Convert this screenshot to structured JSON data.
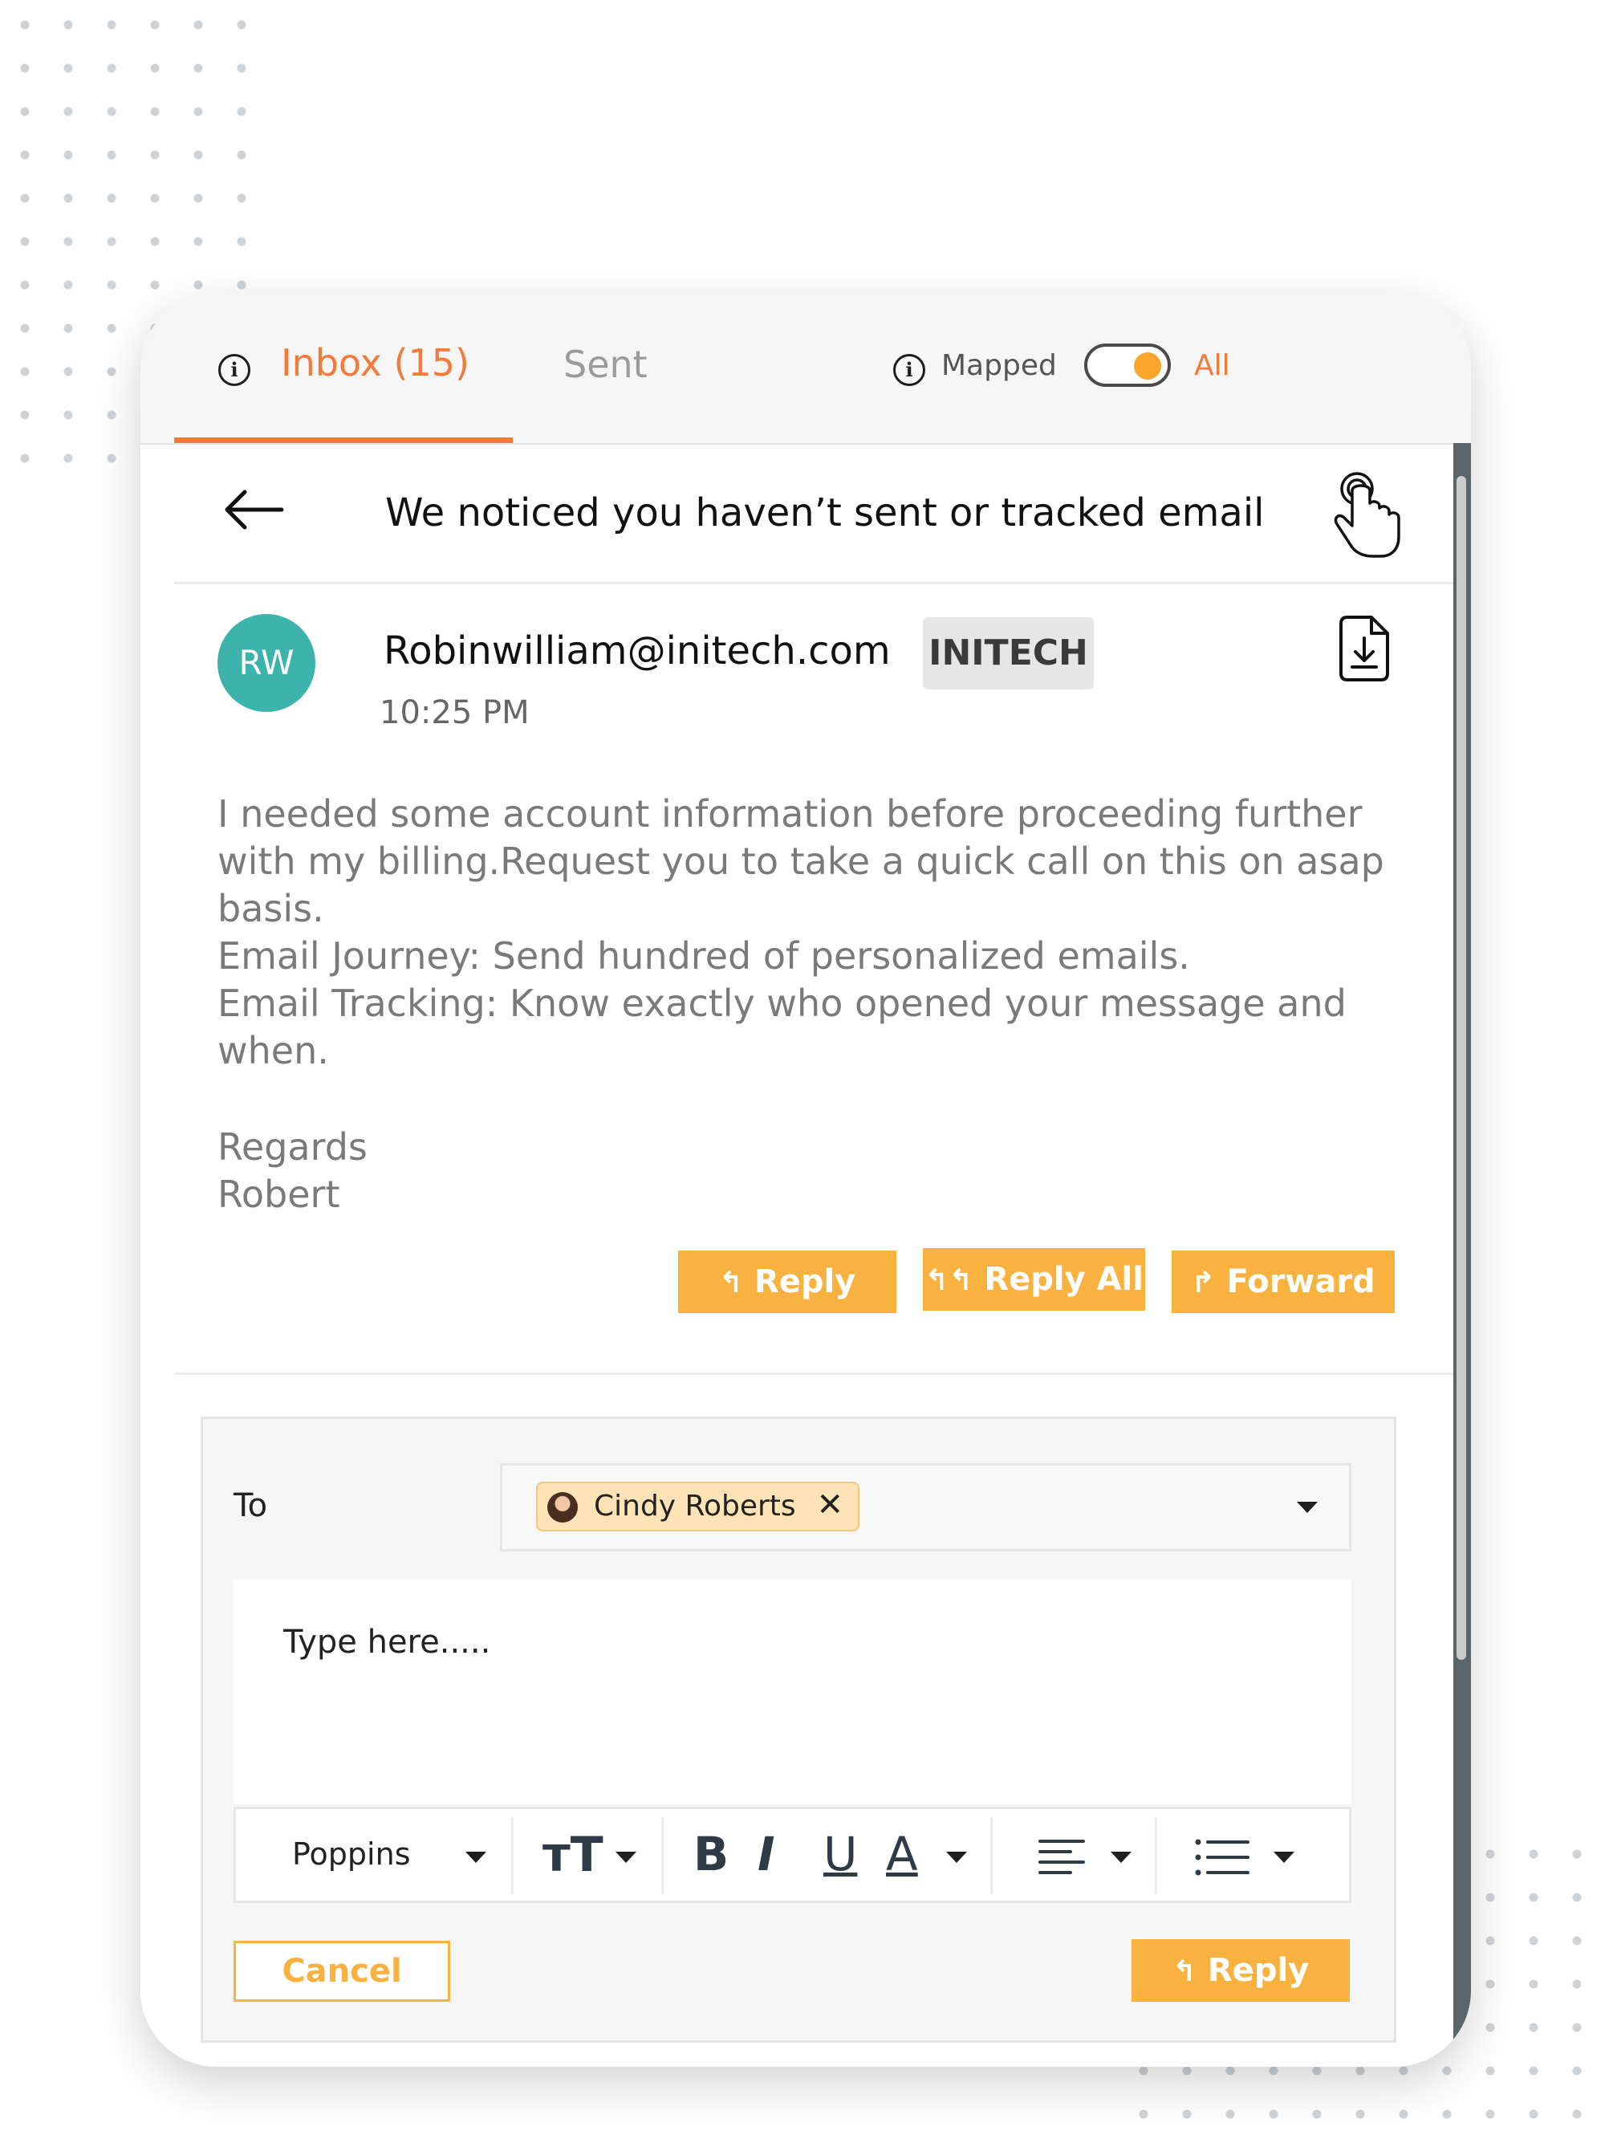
{
  "tabs": {
    "inbox_label": "Inbox (15)",
    "sent_label": "Sent",
    "mapped_label": "Mapped",
    "all_label": "All",
    "toggle_state": "All",
    "info_icon": "i"
  },
  "email": {
    "subject": "We noticed you haven’t sent or tracked email",
    "sender_initials": "RW",
    "sender_email": "Robinwilliam@initech.com",
    "company": "INITECH",
    "time": "10:25 PM",
    "body": [
      "I needed some account information before proceeding further with my billing.Request you to take a quick call on this on asap basis.",
      "Email Journey: Send hundred of personalized emails.",
      "Email Tracking: Know exactly who opened your message and when."
    ],
    "closing": "Regards",
    "signature": "Robert"
  },
  "actions": {
    "reply": "Reply",
    "reply_all": "Reply All",
    "forward": "Forward",
    "reply_icon": "↰",
    "reply_all_icon": "↰↰",
    "forward_icon": "↱"
  },
  "reply_form": {
    "to_label": "To",
    "recipient": "Cindy Roberts",
    "remove_icon": "✕",
    "placeholder": "Type here.....",
    "font": "Poppins",
    "text_size_icon": "тT",
    "bold": "B",
    "italic": "I",
    "underline": "U",
    "font_color": "A",
    "cancel": "Cancel",
    "reply": "Reply"
  },
  "colors": {
    "accent_orange": "#f47a3a",
    "button_orange": "#f9b240",
    "avatar_teal": "#3cb3ab",
    "chip_bg": "#fde3b6"
  }
}
